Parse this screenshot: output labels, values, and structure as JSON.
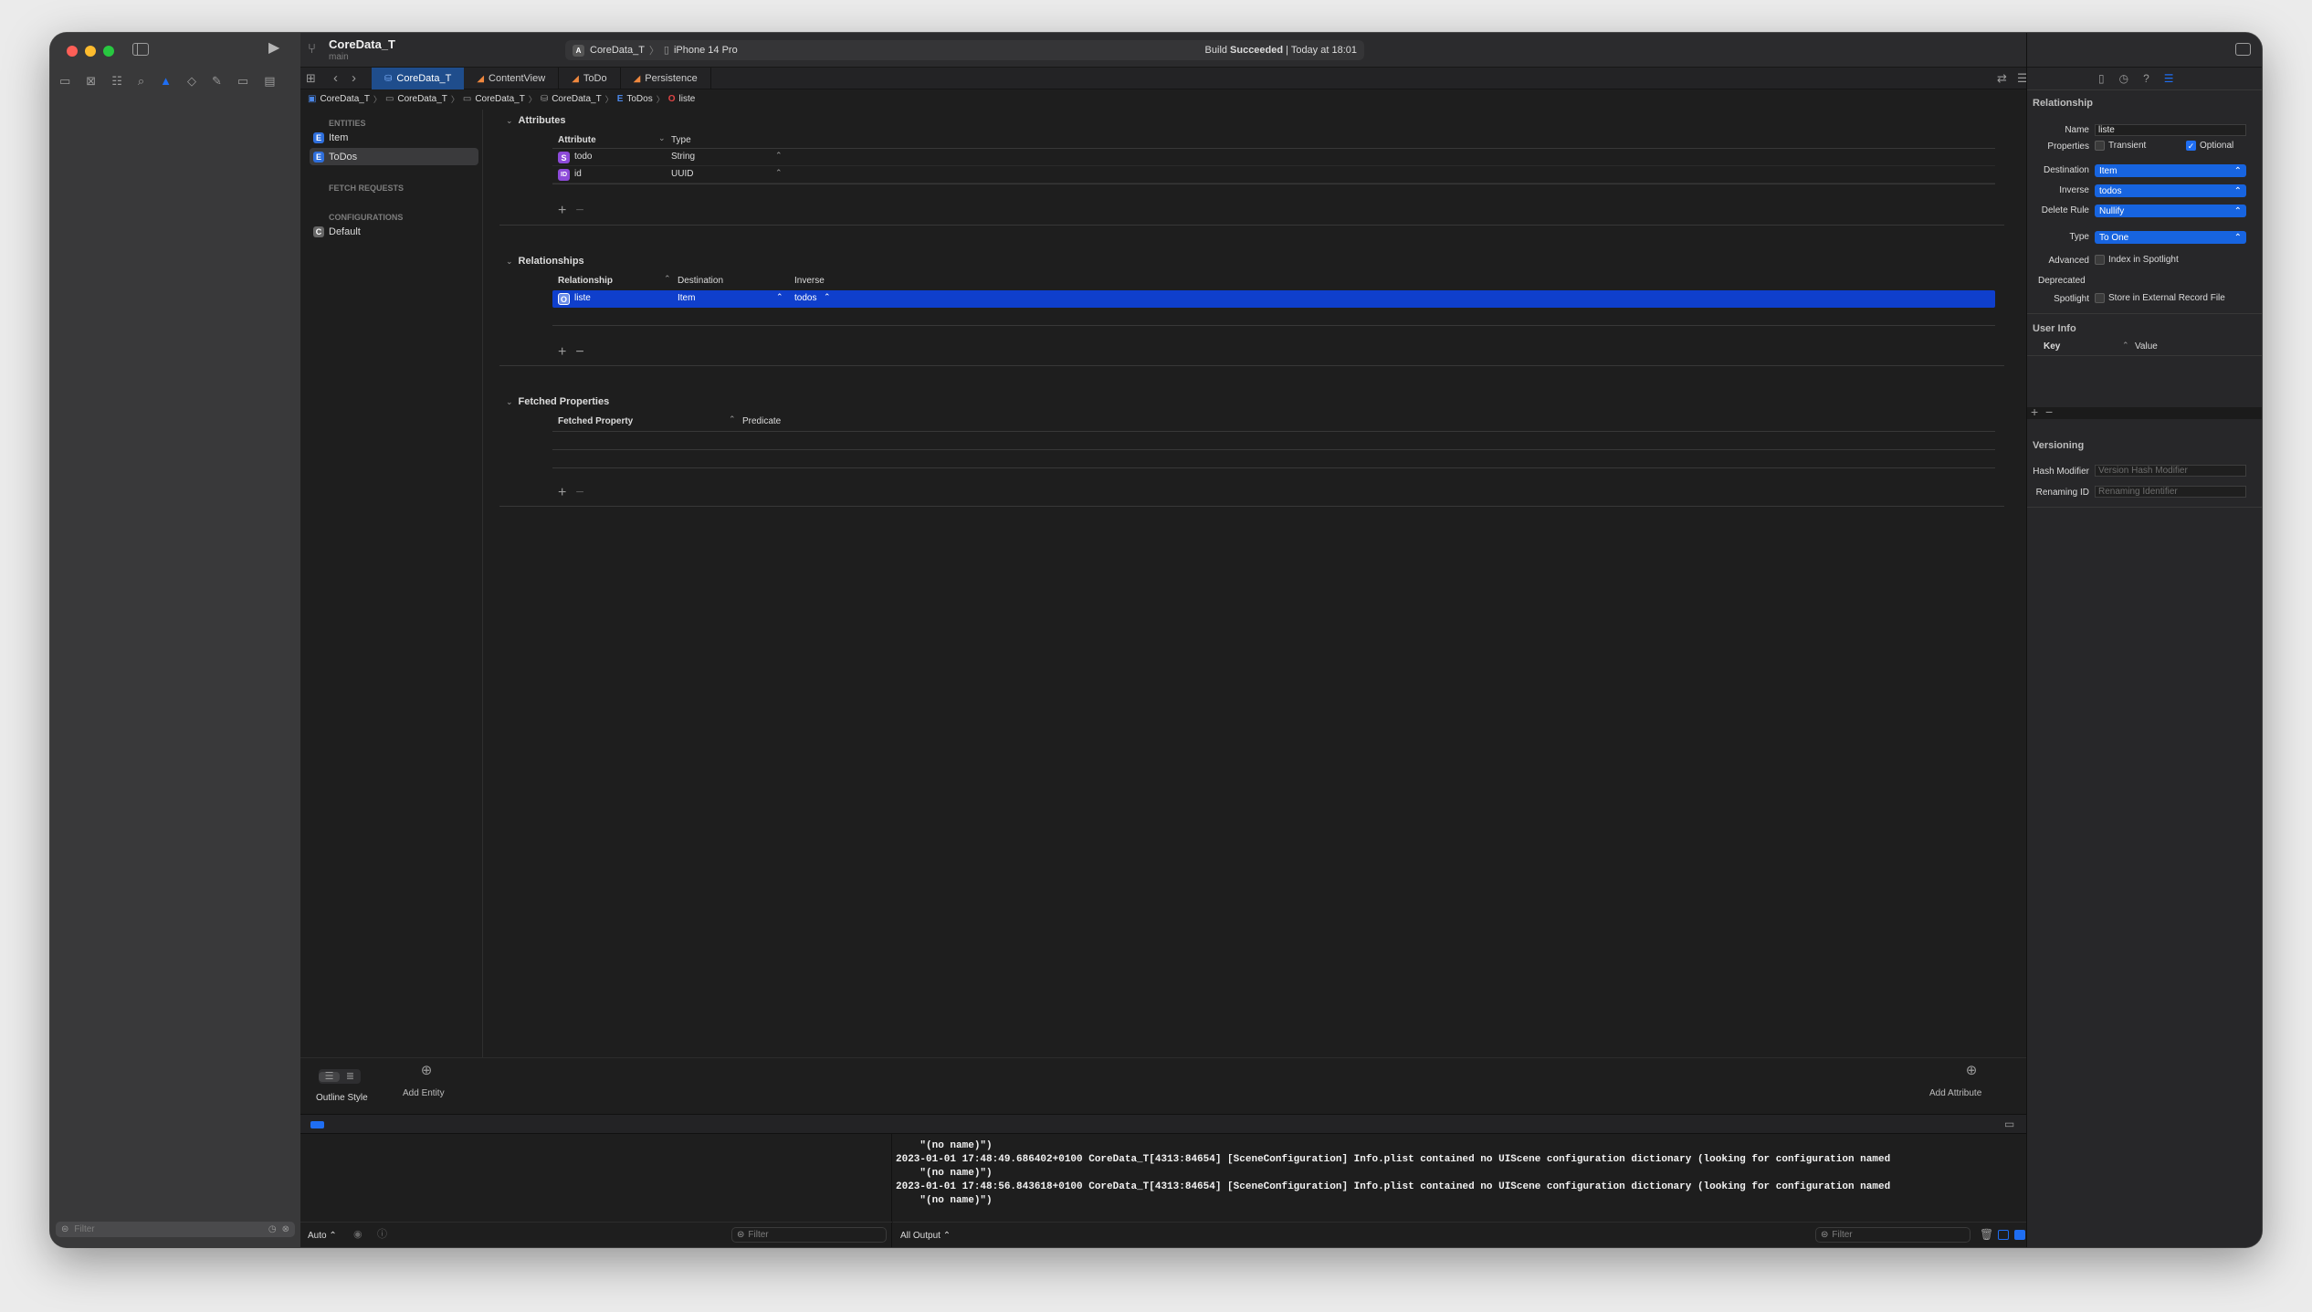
{
  "project": {
    "name": "CoreData_T",
    "branch": "main"
  },
  "toolbar": {
    "scheme": "CoreData_T",
    "device": "iPhone 14 Pro",
    "status_prefix": "Build",
    "status_bold": "Succeeded",
    "status_suffix": "| Today at 18:01"
  },
  "tabs": [
    {
      "label": "CoreData_T",
      "active": true
    },
    {
      "label": "ContentView",
      "active": false
    },
    {
      "label": "ToDo",
      "active": false
    },
    {
      "label": "Persistence",
      "active": false
    }
  ],
  "breadcrumb": [
    "CoreData_T",
    "CoreData_T",
    "CoreData_T",
    "CoreData_T",
    "ToDos",
    "liste"
  ],
  "outline": {
    "entities_header": "ENTITIES",
    "entities": [
      {
        "label": "Item",
        "selected": false
      },
      {
        "label": "ToDos",
        "selected": true
      }
    ],
    "fetch_header": "FETCH REQUESTS",
    "config_header": "CONFIGURATIONS",
    "configs": [
      "Default"
    ]
  },
  "attributes": {
    "title": "Attributes",
    "col_attribute": "Attribute",
    "col_type": "Type",
    "rows": [
      {
        "badge": "S",
        "name": "todo",
        "type": "String"
      },
      {
        "badge": "ID",
        "name": "id",
        "type": "UUID"
      }
    ]
  },
  "relationships": {
    "title": "Relationships",
    "col_relationship": "Relationship",
    "col_destination": "Destination",
    "col_inverse": "Inverse",
    "rows": [
      {
        "badge": "O",
        "name": "liste",
        "destination": "Item",
        "inverse": "todos"
      }
    ]
  },
  "fetched": {
    "title": "Fetched Properties",
    "col_property": "Fetched Property",
    "col_predicate": "Predicate"
  },
  "editor_footer": {
    "outline_style": "Outline Style",
    "add_entity": "Add Entity",
    "add_attribute": "Add Attribute"
  },
  "inspector": {
    "title": "Relationship",
    "name_label": "Name",
    "name_value": "liste",
    "properties_label": "Properties",
    "transient": "Transient",
    "optional": "Optional",
    "destination_label": "Destination",
    "destination_value": "Item",
    "inverse_label": "Inverse",
    "inverse_value": "todos",
    "delete_rule_label": "Delete Rule",
    "delete_rule_value": "Nullify",
    "type_label": "Type",
    "type_value": "To One",
    "advanced_label": "Advanced",
    "index_spotlight": "Index in Spotlight",
    "deprecated_label": "Deprecated",
    "spotlight_label": "Spotlight",
    "external_record": "Store in External Record File",
    "userinfo_title": "User Info",
    "key_col": "Key",
    "value_col": "Value",
    "versioning_title": "Versioning",
    "hash_label": "Hash Modifier",
    "hash_placeholder": "Version Hash Modifier",
    "renaming_label": "Renaming ID",
    "renaming_placeholder": "Renaming Identifier"
  },
  "console": {
    "lines": [
      "    \"(no name)\")",
      "2023-01-01 17:48:49.686402+0100 CoreData_T[4313:84654] [SceneConfiguration] Info.plist contained no UIScene configuration dictionary (looking for configuration named",
      "    \"(no name)\")",
      "2023-01-01 17:48:56.843618+0100 CoreData_T[4313:84654] [SceneConfiguration] Info.plist contained no UIScene configuration dictionary (looking for configuration named",
      "    \"(no name)\")"
    ],
    "auto_label": "Auto",
    "filter_placeholder": "Filter",
    "output_label": "All Output"
  },
  "navigator_filter": "Filter",
  "colors": {
    "accent": "#1764e0",
    "selection": "#0f3fcc",
    "window": "#1e1e1e",
    "sidebar": "#39393a"
  }
}
